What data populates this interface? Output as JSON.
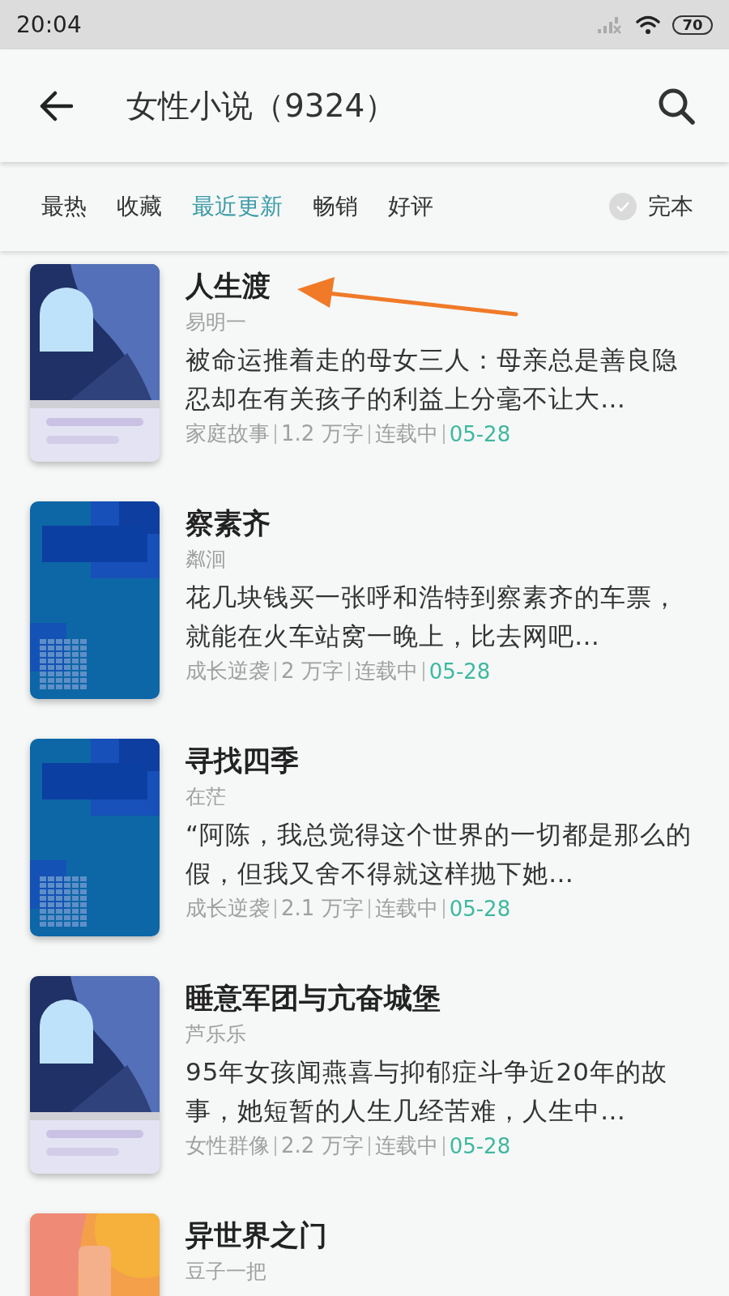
{
  "status_bar": {
    "time": "20:04",
    "battery": "70"
  },
  "header": {
    "title": "女性小说（9324）"
  },
  "tabs": [
    {
      "label": "最热",
      "selected": false
    },
    {
      "label": "收藏",
      "selected": false
    },
    {
      "label": "最近更新",
      "selected": true
    },
    {
      "label": "畅销",
      "selected": false
    },
    {
      "label": "好评",
      "selected": false
    }
  ],
  "finished_filter": {
    "label": "完本",
    "checked": false
  },
  "books": [
    {
      "title": "人生渡",
      "author": "易明一",
      "description": "被命运推着走的母女三人：母亲总是善良隐忍却在有关孩子的利益上分毫不让大…",
      "genre": "家庭故事",
      "words": "1.2 万字",
      "status": "连载中",
      "date": "05-28"
    },
    {
      "title": "察素齐",
      "author": "粼洄",
      "description": "花几块钱买一张呼和浩特到察素齐的车票，就能在火车站窝一晚上，比去网吧…",
      "genre": "成长逆袭",
      "words": "2 万字",
      "status": "连载中",
      "date": "05-28"
    },
    {
      "title": "寻找四季",
      "author": "在茫",
      "description": "“阿陈，我总觉得这个世界的一切都是那么的假，但我又舍不得就这样抛下她…",
      "genre": "成长逆袭",
      "words": "2.1 万字",
      "status": "连载中",
      "date": "05-28"
    },
    {
      "title": "睡意军团与亢奋城堡",
      "author": "芦乐乐",
      "description": "95年女孩闻燕喜与抑郁症斗争近20年的故事，她短暂的人生几经苦难，人生中…",
      "genre": "女性群像",
      "words": "2.2 万字",
      "status": "连载中",
      "date": "05-28"
    },
    {
      "title": "异世界之门",
      "author": "豆子一把"
    }
  ],
  "arrow_annotation": true
}
